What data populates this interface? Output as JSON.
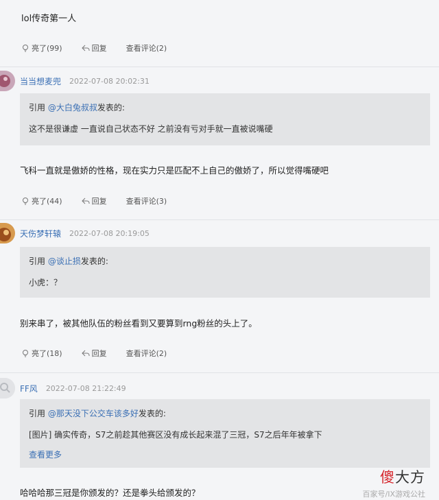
{
  "top_comment": {
    "text": "lol传奇第一人",
    "likes": "亮了(99)",
    "reply": "回复",
    "view_comments": "查看评论(2)"
  },
  "posts": [
    {
      "username": "当当想麦兜",
      "time": "2022-07-08 20:02:31",
      "quote_prefix": "引用 ",
      "quote_user": "@大白兔叔叔",
      "quote_suffix": "发表的:",
      "quote_body": "这不是很谦虚 一直说自己状态不好 之前没有亏对手就一直被说嘴硬",
      "reply_text": "飞科一直就是傲娇的性格，现在实力只是匹配不上自己的傲娇了，所以觉得嘴硬吧",
      "likes": "亮了(44)",
      "reply": "回复",
      "view_comments": "查看评论(3)"
    },
    {
      "username": "天伤梦轩辕",
      "time": "2022-07-08 20:19:05",
      "quote_prefix": "引用 ",
      "quote_user": "@谈止损",
      "quote_suffix": "发表的:",
      "quote_body": "小虎：？",
      "reply_text": "别来串了，被其他队伍的粉丝看到又要算到rng粉丝的头上了。",
      "likes": "亮了(18)",
      "reply": "回复",
      "view_comments": "查看评论(2)"
    },
    {
      "username": "FF风",
      "time": "2022-07-08 21:22:49",
      "quote_prefix": "引用 ",
      "quote_user": "@那天没下公交车该多好",
      "quote_suffix": "发表的:",
      "quote_body": "[图片] 确实传奇，S7之前趁其他赛区没有成长起来混了三冠，S7之后年年被拿下",
      "quote_more": "查看更多",
      "reply_text": "哈哈哈那三冠是你颁发的？还是拳头给颁发的？"
    }
  ],
  "watermark": {
    "logo_red": "傻",
    "logo_rest": "大方",
    "source": "百家号/IX游戏公社"
  },
  "colors": {
    "link": "#3a6fb4",
    "quote_bg": "#e3e4e6",
    "page_bg": "#f4f5f7"
  }
}
